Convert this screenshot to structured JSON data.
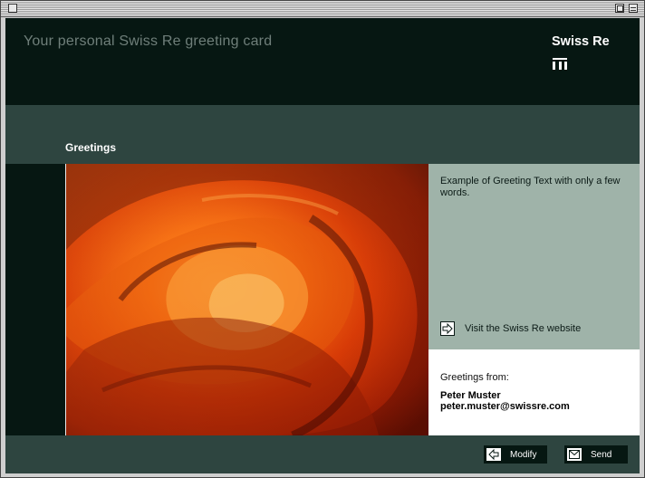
{
  "header": {
    "title": "Your personal Swiss Re greeting card",
    "logo_text": "Swiss Re"
  },
  "section": {
    "label": "Greetings"
  },
  "greeting": {
    "text": "Example of Greeting Text with only a few words.",
    "visit_label": "Visit the Swiss Re website"
  },
  "sender": {
    "from_label": "Greetings from:",
    "name": "Peter Muster",
    "email": "peter.muster@swissre.com"
  },
  "footer": {
    "modify_label": "Modify",
    "send_label": "Send"
  },
  "icons": {
    "visit": "arrow-right-icon",
    "modify": "arrow-left-icon",
    "send": "envelope-icon"
  },
  "colors": {
    "header_bg": "#061712",
    "body_bg": "#2e4540",
    "greeting_panel": "#9fb3a9",
    "photo_accent": "#c52a05"
  }
}
